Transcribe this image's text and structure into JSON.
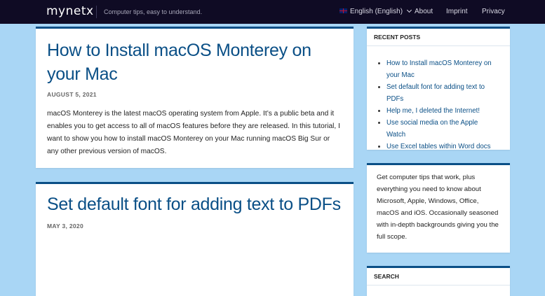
{
  "header": {
    "logo": "mynetx",
    "tagline": "Computer tips, easy to understand.",
    "nav": {
      "language": "English (English)",
      "about": "About",
      "imprint": "Imprint",
      "privacy": "Privacy"
    }
  },
  "posts": [
    {
      "title": "How to Install macOS Monterey on your Mac",
      "date": "August 5, 2021",
      "excerpt": "macOS Monterey is the latest macOS operating system from Apple. It’s a public beta and it enables you to get access to all of macOS features before they are released. In this tutorial, I want to show you how to install macOS Monterey on your Mac running macOS Big Sur or any other previous version of macOS."
    },
    {
      "title": "Set default font for adding text to PDFs",
      "date": "May 3, 2020"
    }
  ],
  "sidebar": {
    "recent_posts": {
      "heading": "RECENT POSTS",
      "items": [
        "How to Install macOS Monterey on your Mac",
        "Set default font for adding text to PDFs",
        "Help me, I deleted the Internet!",
        "Use social media on the Apple Watch",
        "Use Excel tables within Word docs"
      ]
    },
    "about": "Get computer tips that work, plus everything you need to know about Microsoft, Apple, Windows, Office, macOS and iOS. Occasionally seasoned with in-depth backgrounds giving you the full scope.",
    "search": {
      "heading": "SEARCH"
    }
  },
  "colors": {
    "header_bg": "#0f0b24",
    "page_bg": "#a9d6f5",
    "accent": "#0a4f86"
  }
}
